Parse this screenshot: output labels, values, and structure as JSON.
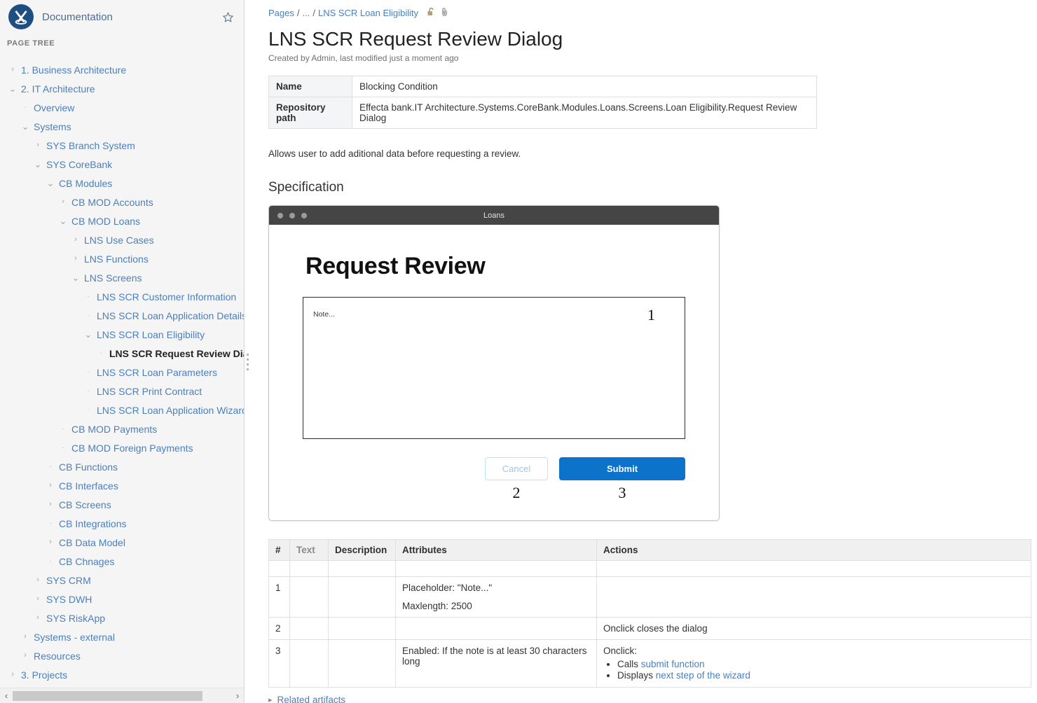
{
  "sidebar": {
    "space_name": "Documentation",
    "logo_icon": "crossed-pins-logo",
    "star_icon": "star-icon",
    "tree_heading": "PAGE TREE",
    "scroll_left_icon": "chevron-left-icon",
    "scroll_right_icon": "chevron-right-icon",
    "items": [
      {
        "label": "1. Business Architecture",
        "indent": 0,
        "marker": "collapsed",
        "current": false
      },
      {
        "label": "2. IT Architecture",
        "indent": 0,
        "marker": "expanded",
        "current": false
      },
      {
        "label": "Overview",
        "indent": 1,
        "marker": "leaf",
        "current": false
      },
      {
        "label": "Systems",
        "indent": 1,
        "marker": "expanded",
        "current": false
      },
      {
        "label": "SYS Branch System",
        "indent": 2,
        "marker": "collapsed",
        "current": false
      },
      {
        "label": "SYS CoreBank",
        "indent": 2,
        "marker": "expanded",
        "current": false
      },
      {
        "label": "CB Modules",
        "indent": 3,
        "marker": "expanded",
        "current": false
      },
      {
        "label": "CB MOD Accounts",
        "indent": 4,
        "marker": "collapsed",
        "current": false
      },
      {
        "label": "CB MOD Loans",
        "indent": 4,
        "marker": "expanded",
        "current": false
      },
      {
        "label": "LNS Use Cases",
        "indent": 5,
        "marker": "collapsed",
        "current": false
      },
      {
        "label": "LNS Functions",
        "indent": 5,
        "marker": "collapsed",
        "current": false
      },
      {
        "label": "LNS Screens",
        "indent": 5,
        "marker": "expanded",
        "current": false
      },
      {
        "label": "LNS SCR Customer Information",
        "indent": 6,
        "marker": "leaf",
        "current": false
      },
      {
        "label": "LNS SCR Loan Application Details",
        "indent": 6,
        "marker": "leaf",
        "current": false
      },
      {
        "label": "LNS SCR Loan Eligibility",
        "indent": 6,
        "marker": "expanded",
        "current": false
      },
      {
        "label": "LNS SCR Request Review Dialog",
        "indent": 7,
        "marker": "leaf",
        "current": true
      },
      {
        "label": "LNS SCR Loan Parameters",
        "indent": 6,
        "marker": "leaf",
        "current": false
      },
      {
        "label": "LNS SCR Print Contract",
        "indent": 6,
        "marker": "leaf",
        "current": false
      },
      {
        "label": "LNS SCR Loan Application Wizard Header",
        "indent": 6,
        "marker": "leaf",
        "current": false
      },
      {
        "label": "CB MOD Payments",
        "indent": 4,
        "marker": "leaf",
        "current": false
      },
      {
        "label": "CB MOD Foreign Payments",
        "indent": 4,
        "marker": "leaf",
        "current": false
      },
      {
        "label": "CB Functions",
        "indent": 3,
        "marker": "leaf",
        "current": false
      },
      {
        "label": "CB Interfaces",
        "indent": 3,
        "marker": "collapsed",
        "current": false
      },
      {
        "label": "CB Screens",
        "indent": 3,
        "marker": "collapsed",
        "current": false
      },
      {
        "label": "CB Integrations",
        "indent": 3,
        "marker": "leaf",
        "current": false
      },
      {
        "label": "CB Data Model",
        "indent": 3,
        "marker": "collapsed",
        "current": false
      },
      {
        "label": "CB Chnages",
        "indent": 3,
        "marker": "leaf",
        "current": false
      },
      {
        "label": "SYS CRM",
        "indent": 2,
        "marker": "collapsed",
        "current": false
      },
      {
        "label": "SYS DWH",
        "indent": 2,
        "marker": "collapsed",
        "current": false
      },
      {
        "label": "SYS RiskApp",
        "indent": 2,
        "marker": "collapsed",
        "current": false
      },
      {
        "label": "Systems - external",
        "indent": 1,
        "marker": "collapsed",
        "current": false
      },
      {
        "label": "Resources",
        "indent": 1,
        "marker": "collapsed",
        "current": false
      },
      {
        "label": "3. Projects",
        "indent": 0,
        "marker": "collapsed",
        "current": false
      }
    ]
  },
  "breadcrumb": {
    "root": "Pages",
    "ellipsis": "...",
    "parent": "LNS SCR Loan Eligibility",
    "separator": "/",
    "lock_icon": "unlocked-padlock-icon",
    "attachment_icon": "paperclip-icon"
  },
  "page": {
    "title": "LNS SCR Request Review Dialog",
    "byline": "Created by Admin, last modified just a moment ago",
    "intro": "Allows user to add aditional data before requesting a review.",
    "section_heading": "Specification"
  },
  "properties": {
    "name_key": "Name",
    "name_value": "Blocking Condition",
    "path_key": "Repository path",
    "path_value": "Effecta bank.IT Architecture.Systems.CoreBank.Modules.Loans.Screens.Loan Eligibility.Request Review Dialog"
  },
  "mockup": {
    "window_title": "Loans",
    "heading": "Request Review",
    "note_placeholder": "Note...",
    "note_callout": "1",
    "cancel_label": "Cancel",
    "cancel_callout": "2",
    "submit_label": "Submit",
    "submit_callout": "3",
    "accent_color": "#0d72c9",
    "titlebar_color": "#454545"
  },
  "spec_table": {
    "headers": [
      "#",
      "Text",
      "Description",
      "Attributes",
      "Actions"
    ],
    "rows": [
      {
        "num": "",
        "text": "",
        "description": "",
        "attributes": [],
        "actions_lead": "",
        "actions_items": []
      },
      {
        "num": "1",
        "text": "",
        "description": "",
        "attributes": [
          "Placeholder: \"Note...\"",
          "Maxlength: 2500"
        ],
        "actions_lead": "",
        "actions_items": []
      },
      {
        "num": "2",
        "text": "",
        "description": "",
        "attributes": [],
        "actions_lead": "Onclick closes the dialog",
        "actions_items": []
      },
      {
        "num": "3",
        "text": "",
        "description": "",
        "attributes": [
          "Enabled: If the note is at least 30 characters long"
        ],
        "actions_lead": "Onclick:",
        "actions_items": [
          {
            "prefix": "Calls ",
            "link": "submit function"
          },
          {
            "prefix": "Displays ",
            "link": "next step of the wizard"
          }
        ]
      }
    ]
  },
  "related": {
    "twisty_icon": "chevron-right-icon",
    "label": "Related artifacts"
  }
}
